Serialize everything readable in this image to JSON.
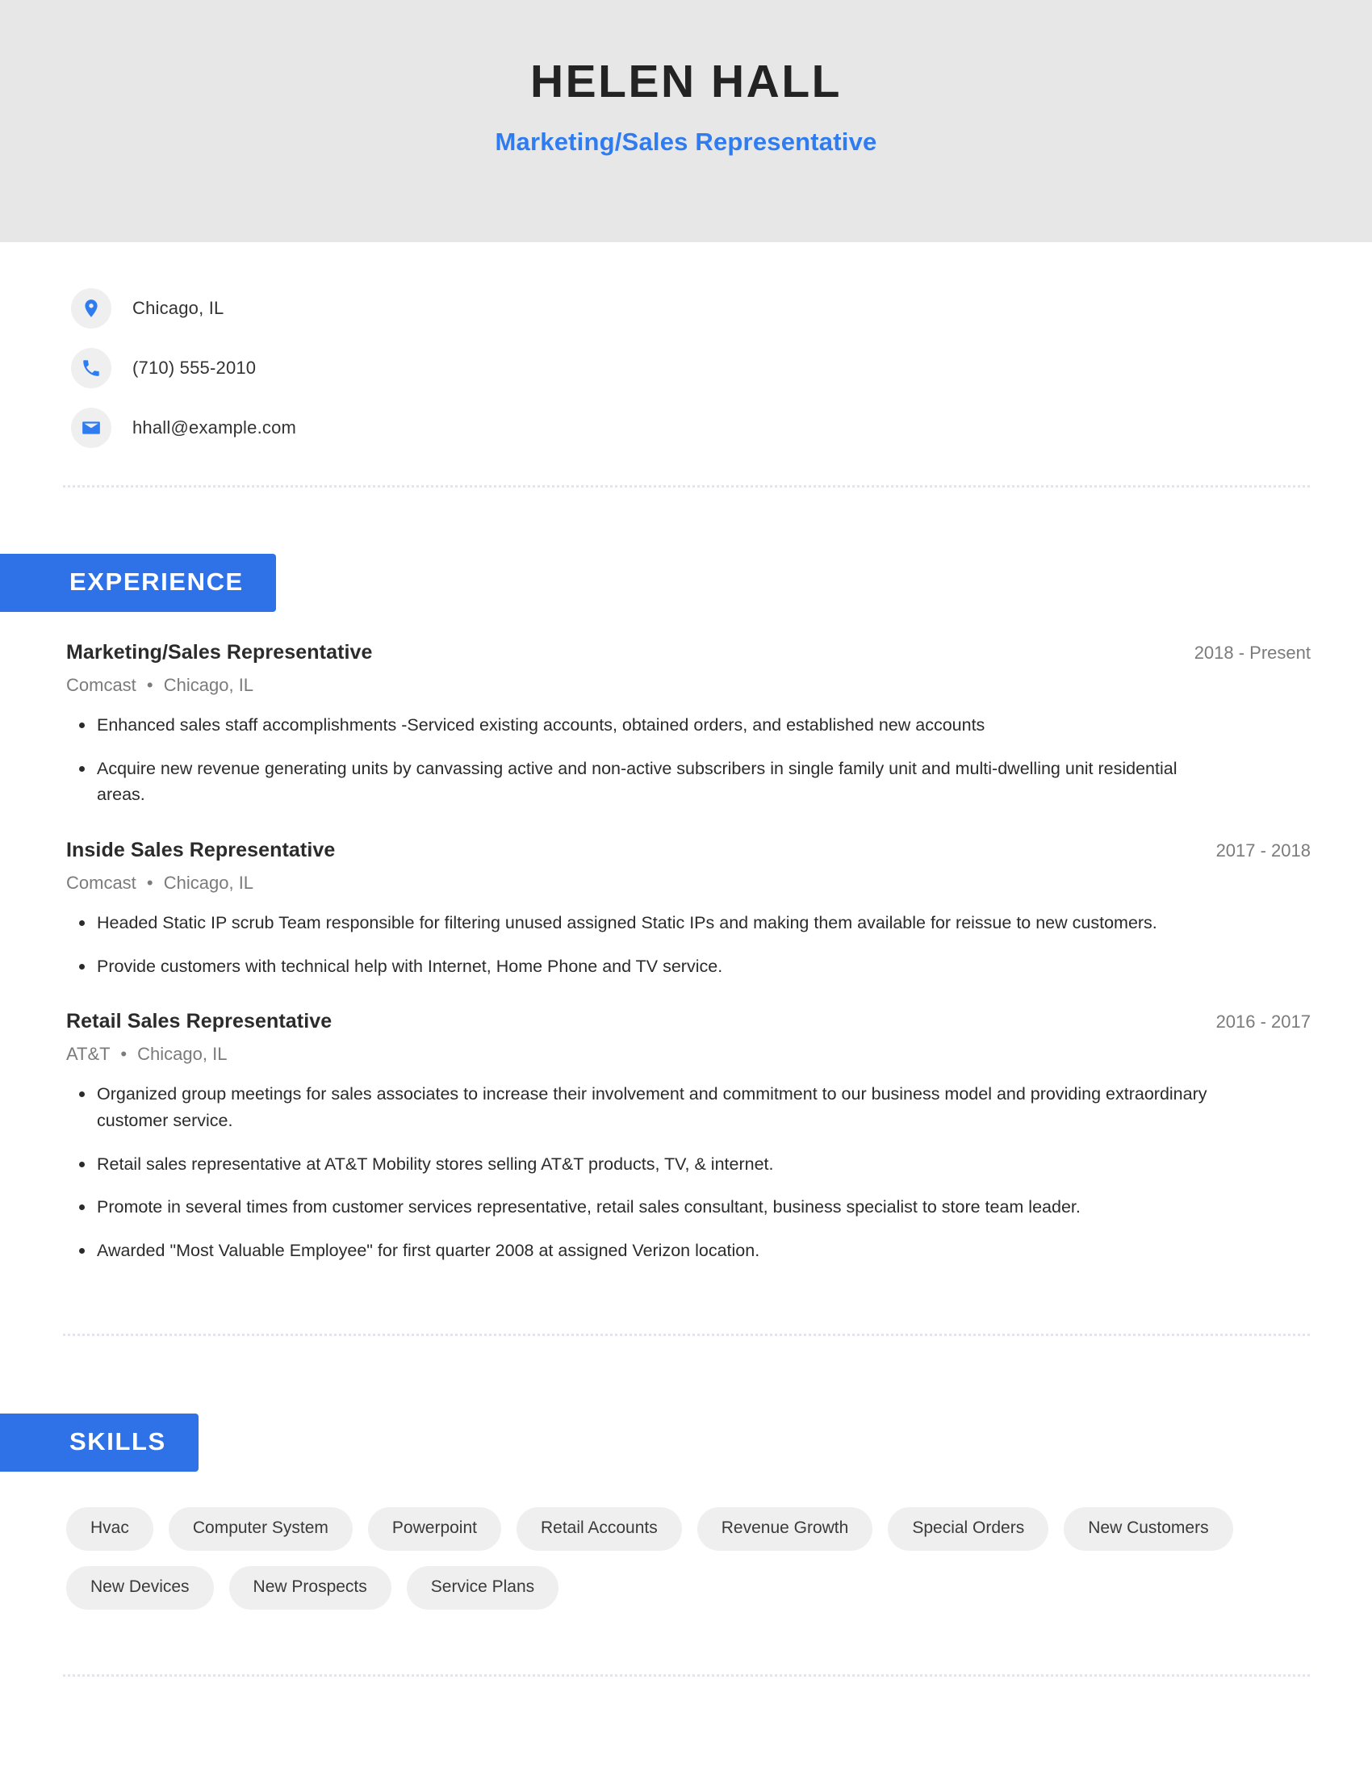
{
  "theme": {
    "accent_blue": "#2f72e8",
    "header_background": "#e7e7e7",
    "pill_background": "#efefef",
    "muted_text": "#7b7b7b"
  },
  "header": {
    "name": "HELEN HALL",
    "headline": "Marketing/Sales Representative"
  },
  "contact": {
    "items": [
      {
        "icon": "location-pin-icon",
        "value": "Chicago, IL"
      },
      {
        "icon": "phone-icon",
        "value": "(710) 555-2010"
      },
      {
        "icon": "email-icon",
        "value": "hhall@example.com"
      }
    ]
  },
  "sections": {
    "experience": {
      "title": "EXPERIENCE",
      "jobs": [
        {
          "title": "Marketing/Sales Representative",
          "company": "Comcast",
          "separator": "•",
          "location": "Chicago, IL",
          "dates": "2018 - Present",
          "bullets": [
            "Enhanced sales staff accomplishments -Serviced existing accounts, obtained orders, and established new accounts",
            "Acquire new revenue generating units by canvassing active and non-active subscribers in single family unit and multi-dwelling unit residential areas."
          ]
        },
        {
          "title": "Inside Sales Representative",
          "company": "Comcast",
          "separator": "•",
          "location": "Chicago, IL",
          "dates": "2017 - 2018",
          "bullets": [
            "Headed Static IP scrub Team responsible for filtering unused assigned Static IPs and making them available for reissue to new customers.",
            "Provide customers with technical help with Internet, Home Phone and TV service."
          ]
        },
        {
          "title": "Retail Sales Representative",
          "company": "AT&T",
          "separator": "•",
          "location": "Chicago, IL",
          "dates": "2016 - 2017",
          "bullets": [
            "Organized group meetings for sales associates to increase their involvement and commitment to our business model and providing extraordinary customer service.",
            "Retail sales representative at AT&T Mobility stores selling AT&T products, TV, & internet.",
            "Promote in several times from customer services representative, retail sales consultant, business specialist to store team leader.",
            "Awarded \"Most Valuable Employee\" for first quarter 2008 at assigned Verizon location."
          ]
        }
      ]
    },
    "skills": {
      "title": "SKILLS",
      "items": [
        "Hvac",
        "Computer System",
        "Powerpoint",
        "Retail Accounts",
        "Revenue Growth",
        "Special Orders",
        "New Customers",
        "New Devices",
        "New Prospects",
        "Service Plans"
      ]
    }
  }
}
